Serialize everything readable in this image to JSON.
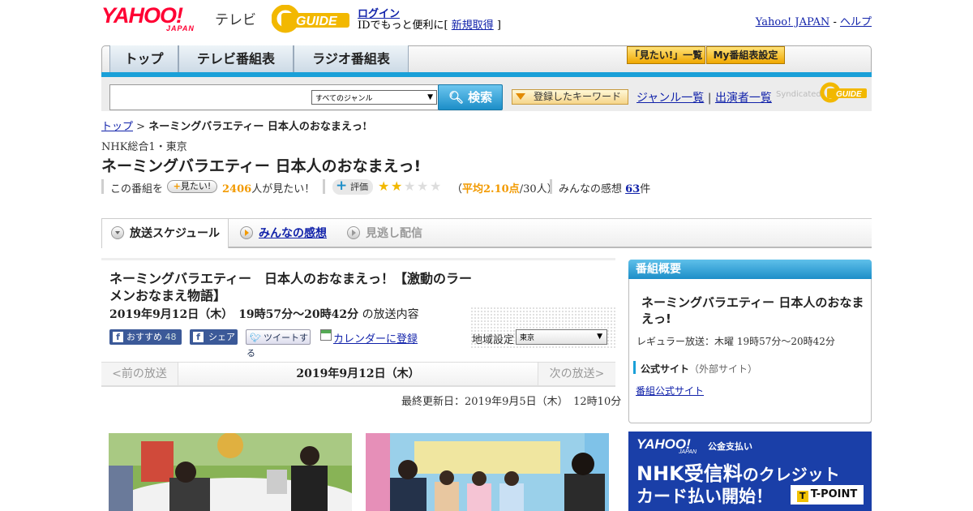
{
  "header": {
    "logo_yahoo": "YAHOO!",
    "logo_japan": "JAPAN",
    "logo_tv": "テレビ",
    "gguide": "GUIDE",
    "login": "ログイン",
    "id_prefix": "IDでもっと便利に[ ",
    "signup": "新規取得",
    "id_suffix": " ]",
    "yahoo_japan_link": "Yahoo! JAPAN",
    "sep": " - ",
    "help_link": "ヘルプ"
  },
  "nav": {
    "tabs": [
      "トップ",
      "テレビ番組表",
      "ラジオ番組表"
    ],
    "mitai_list": "「見たい!」一覧",
    "my_schedule": "My番組表設定"
  },
  "search": {
    "placeholder": "",
    "genre_selected": "すべてのジャンル",
    "button": "検索",
    "keyword": "登録したキーワード",
    "genre_list": "ジャンル一覧",
    "sep": " | ",
    "performer_list": "出演者一覧",
    "syndicated": "Syndicated"
  },
  "breadcrumb": {
    "top": "トップ",
    "sep": " > ",
    "current": "ネーミングバラエティー 日本人のおなまえっ!"
  },
  "program": {
    "channel": "NHK総合1・東京",
    "title": "ネーミングバラエティー 日本人のおなまえっ!",
    "prefix": "この番組を",
    "mitai_btn": "見たい!",
    "mitai_count": "2406",
    "mitai_suffix": "人が見たい！",
    "rate_btn": "評価",
    "rating": 2,
    "stars_max": 5,
    "avg_prefix": "（",
    "avg_value": "平均2.10点",
    "avg_suffix": "/30人）",
    "kanso_label": "みんなの感想 ",
    "kanso_count": "63",
    "kanso_suffix": "件",
    "colors": {
      "accent_blue": "#1c8ec8",
      "orange": "#f29a00",
      "star_on": "#f2b800",
      "star_off": "#dddddd"
    }
  },
  "subtabs": {
    "schedule": "放送スケジュール",
    "kanso": "みんなの感想",
    "minogashi": "見逃し配信"
  },
  "detail": {
    "episode_title": "ネーミングバラエティー　日本人のおなまえっ！【激動のラーメンおなまえ物語】",
    "date": "2019年9月12日（木）　19時57分～20時42分",
    "date_suffix": "の放送内容",
    "osusume": "おすすめ",
    "osusume_count": "48",
    "share": "シェア",
    "tweet": "ツイートする",
    "calendar": "カレンダーに登録",
    "region_label": "地域設定",
    "region_selected": "東京",
    "prev": "<前の放送",
    "current_date": "2019年9月12日（木）",
    "next": "次の放送>",
    "updated": "最終更新日：2019年9月5日（木）　12時10分"
  },
  "sidebar": {
    "heading": "番組概要",
    "title": "ネーミングバラエティー 日本人のおなまえっ!",
    "regular": "レギュラー放送：木曜 19時57分～20時42分",
    "official_label": "公式サイト",
    "official_note": "（外部サイト）",
    "official_link": "番組公式サイト"
  },
  "ad": {
    "brand": "YAHOO!",
    "brand_sub": "JAPAN",
    "kind": "公金支払い",
    "line1": "NHK受信料",
    "line1_b": "のクレジット",
    "line2": "カード払い開始",
    "line2_b": "！",
    "tpoint": "T-POINT"
  }
}
